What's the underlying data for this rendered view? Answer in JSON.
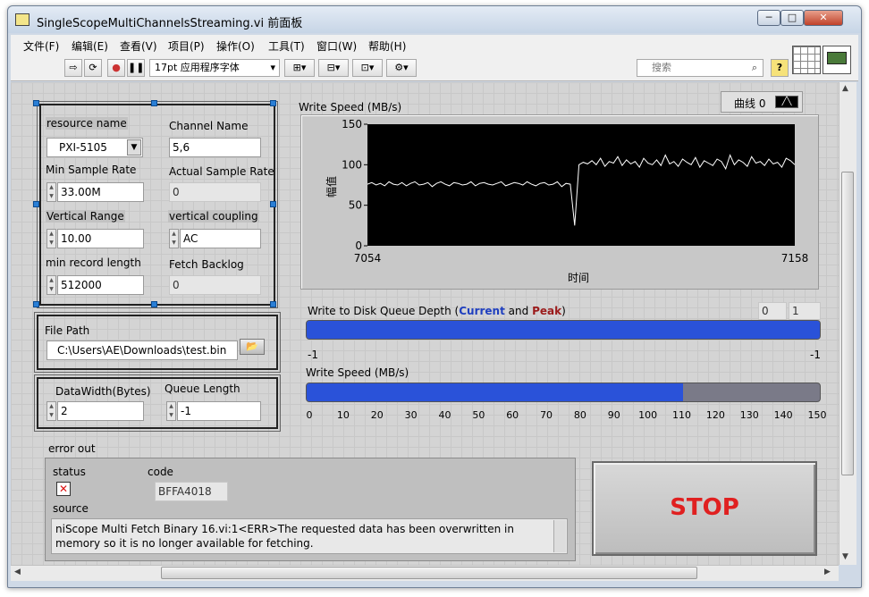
{
  "window": {
    "title": "SingleScopeMultiChannelsStreaming.vi 前面板"
  },
  "menu": [
    "文件(F)",
    "编辑(E)",
    "查看(V)",
    "项目(P)",
    "操作(O)",
    "工具(T)",
    "窗口(W)",
    "帮助(H)"
  ],
  "toolbar": {
    "font_selector": "17pt 应用程序字体",
    "search_placeholder": "搜索",
    "help_label": "?"
  },
  "controls": {
    "resource_name": {
      "label": "resource name",
      "value": "PXI-5105"
    },
    "channel_name": {
      "label": "Channel Name",
      "value": "5,6"
    },
    "min_sample_rate": {
      "label": "Min Sample Rate",
      "value": "33.00M"
    },
    "actual_sample_rate": {
      "label": "Actual Sample Rate",
      "value": "0"
    },
    "vertical_range": {
      "label": "Vertical Range",
      "value": "10.00"
    },
    "vertical_coupling": {
      "label": "vertical coupling",
      "value": "AC"
    },
    "min_record_length": {
      "label": "min record length",
      "value": "512000"
    },
    "fetch_backlog": {
      "label": "Fetch Backlog",
      "value": "0"
    },
    "file_path": {
      "label": "File Path",
      "value": "C:\\Users\\AE\\Downloads\\test.bin"
    },
    "data_width": {
      "label": "DataWidth(Bytes)",
      "value": "2"
    },
    "queue_length": {
      "label": "Queue Length",
      "value": "-1"
    }
  },
  "graph": {
    "title": "Write Speed (MB/s)",
    "legend": "曲线 0",
    "ylabel": "幅值",
    "xlabel": "时间"
  },
  "queue": {
    "label_prefix": "Write to Disk Queue Depth (",
    "current_word": "Current",
    "and_word": " and ",
    "peak_word": "Peak",
    "label_suffix": ")",
    "current_value": "0",
    "peak_value": "1",
    "min_label": "-1",
    "max_label": "-1",
    "fill": 1.0
  },
  "speed_bar": {
    "label": "Write Speed (MB/s)",
    "value": 110,
    "max": 150,
    "ticks": [
      "0",
      "10",
      "20",
      "30",
      "40",
      "50",
      "60",
      "70",
      "80",
      "90",
      "100",
      "110",
      "120",
      "130",
      "140",
      "150"
    ]
  },
  "error_out": {
    "label": "error out",
    "status_label": "status",
    "code_label": "code",
    "code_value": "BFFA4018",
    "source_label": "source",
    "source_text": "niScope Multi Fetch Binary 16.vi:1<ERR>The requested data has been overwritten in memory so it is no longer available for fetching."
  },
  "stop": {
    "label": "STOP"
  },
  "colors": {
    "current": "#1f3fbf",
    "peak": "#9b1b1b",
    "stop": "#e02020",
    "bar": "#2a52d9"
  },
  "chart_data": {
    "type": "line",
    "xlim": [
      7054,
      7158
    ],
    "ylim": [
      0,
      150
    ],
    "xticks": [
      "7054",
      "7158"
    ],
    "yticks": [
      "0",
      "50",
      "100",
      "150"
    ],
    "xlabel": "时间",
    "ylabel": "幅值",
    "series": [
      {
        "values": [
          76,
          78,
          75,
          77,
          74,
          79,
          76,
          75,
          78,
          74,
          77,
          79,
          75,
          76,
          78,
          73,
          77,
          79,
          76,
          74,
          78,
          77,
          75,
          76,
          79,
          74,
          77,
          78,
          76,
          75,
          77,
          79,
          74,
          76,
          78,
          77,
          75,
          79,
          76,
          74,
          77,
          78,
          75,
          76,
          79,
          73,
          77,
          76,
          25,
          100,
          103,
          101,
          105,
          100,
          108,
          98,
          104,
          102,
          110,
          99,
          106,
          101,
          104,
          97,
          108,
          102,
          100,
          106,
          99,
          112,
          101,
          104,
          98,
          107,
          103,
          100,
          109,
          97,
          105,
          102,
          99,
          107,
          104,
          95,
          112,
          100,
          106,
          103,
          98,
          110,
          102,
          104,
          99,
          107,
          101,
          103,
          97,
          108,
          105,
          100
        ]
      }
    ]
  }
}
